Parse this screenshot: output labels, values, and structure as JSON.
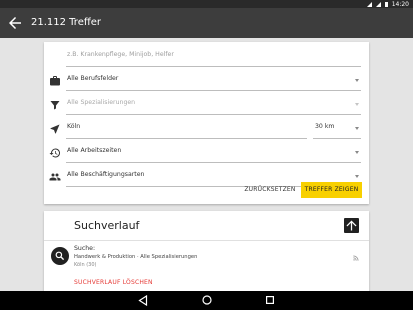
{
  "status_bar": {
    "time": "14:20"
  },
  "app_bar": {
    "title": "21.112 Treffer"
  },
  "form": {
    "keyword_placeholder": "z.B. Krankenpflege, Minijob, Helfer",
    "job_field": "Alle Berufsfelder",
    "specialization": "Alle Spezialisierungen",
    "location": "Köln",
    "radius": "30 km",
    "working_hours": "Alle Arbeitszeiten",
    "employment_type": "Alle Beschäftigungsarten",
    "reset_label": "ZURÜCKSETZEN",
    "show_label": "TREFFER ZEIGEN",
    "accent_color": "#f8d000"
  },
  "history": {
    "title": "Suchverlauf",
    "item": {
      "label": "Suche:",
      "detail": "Handwerk & Produktion · Alle Spezialisierungen",
      "location": "Köln (30)"
    },
    "delete_label": "SUCHVERLAUF LÖSCHEN",
    "delete_color": "#e53935"
  }
}
